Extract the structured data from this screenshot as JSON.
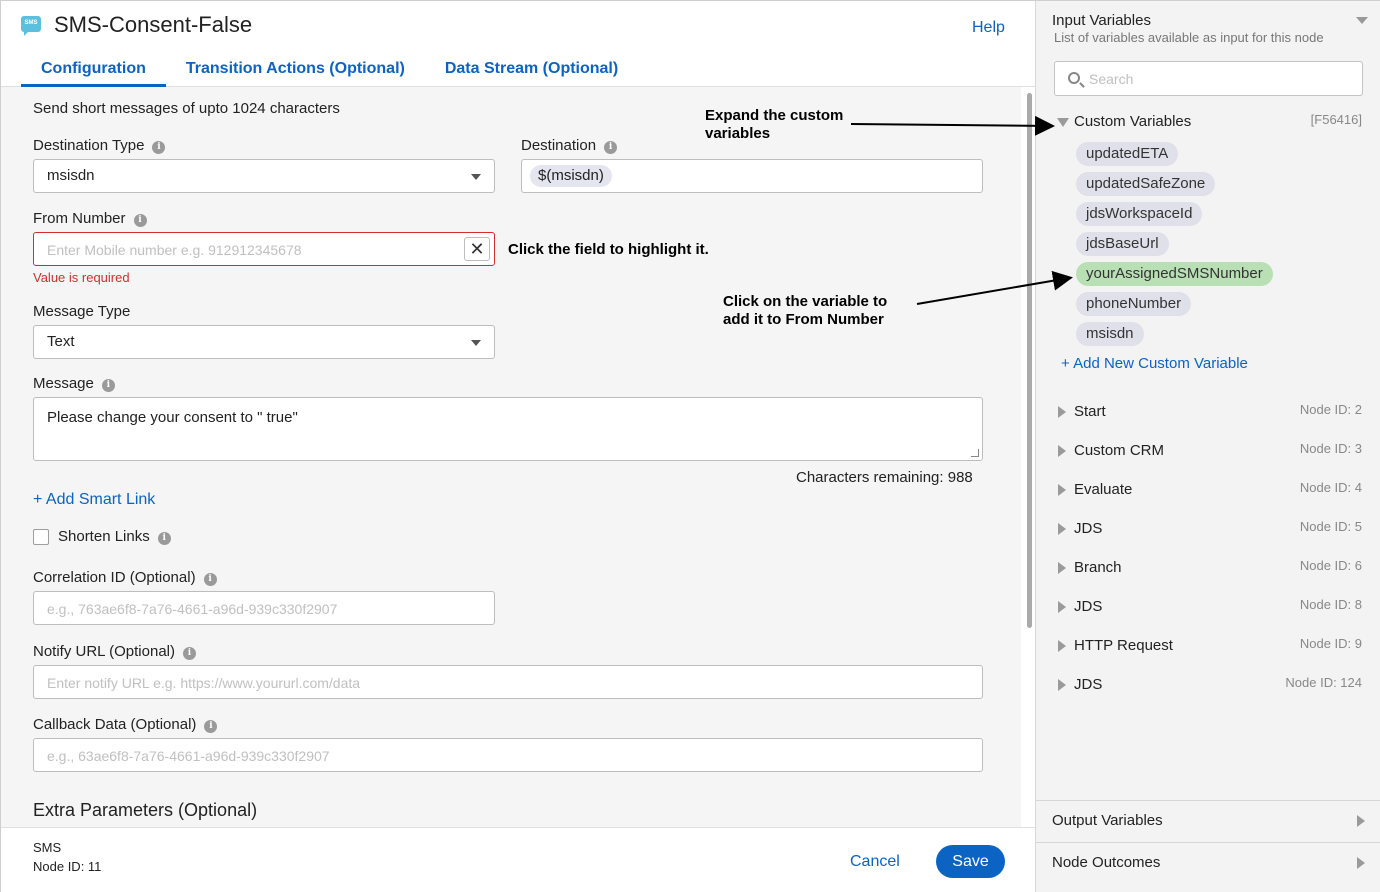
{
  "header": {
    "icon": "sms-icon",
    "icon_text": "SMS",
    "title": "SMS-Consent-False",
    "help": "Help",
    "tabs": [
      {
        "label": "Configuration"
      },
      {
        "label": "Transition Actions (Optional)"
      },
      {
        "label": "Data Stream (Optional)"
      }
    ]
  },
  "form": {
    "description": "Send short messages of upto 1024 characters",
    "destination_type": {
      "label": "Destination Type",
      "value": "msisdn"
    },
    "destination": {
      "label": "Destination",
      "chip": "$(msisdn)"
    },
    "from_number": {
      "label": "From Number",
      "placeholder": "Enter Mobile number e.g. 912912345678",
      "error": "Value is required"
    },
    "message_type": {
      "label": "Message Type",
      "value": "Text"
    },
    "message": {
      "label": "Message",
      "value": "Please change your consent to \" true\"",
      "remaining": "Characters remaining: 988"
    },
    "add_smart_link": "+ Add Smart Link",
    "shorten_links": "Shorten Links",
    "correlation_id": {
      "label": "Correlation ID (Optional)",
      "placeholder": "e.g., 763ae6f8-7a76-4661-a96d-939c330f2907"
    },
    "notify_url": {
      "label": "Notify URL (Optional)",
      "placeholder": "Enter notify URL e.g. https://www.yoururl.com/data"
    },
    "callback_data": {
      "label": "Callback Data (Optional)",
      "placeholder": "e.g., 63ae6f8-7a76-4661-a96d-939c330f2907"
    },
    "extra_parameters": "Extra Parameters (Optional)"
  },
  "annotations": {
    "expand_line1": "Expand the custom",
    "expand_line2": "variables",
    "click_field": "Click the field to highlight it.",
    "click_var_line1": "Click on the variable to",
    "click_var_line2": "add it to From Number"
  },
  "footer": {
    "node_type": "SMS",
    "node_id": "Node ID: 11",
    "cancel": "Cancel",
    "save": "Save"
  },
  "input_panel": {
    "title": "Input Variables",
    "subtitle": "List of variables available as input for this node",
    "search_placeholder": "Search",
    "custom_variables": {
      "label": "Custom Variables",
      "id": "[F56416]",
      "items": [
        "updatedETA",
        "updatedSafeZone",
        "jdsWorkspaceId",
        "jdsBaseUrl",
        "yourAssignedSMSNumber",
        "phoneNumber",
        "msisdn"
      ],
      "add_new": "+ Add New Custom Variable"
    },
    "nodes": [
      {
        "label": "Start",
        "id": "Node ID: 2"
      },
      {
        "label": "Custom CRM",
        "id": "Node ID: 3"
      },
      {
        "label": "Evaluate",
        "id": "Node ID: 4"
      },
      {
        "label": "JDS",
        "id": "Node ID: 5"
      },
      {
        "label": "Branch",
        "id": "Node ID: 6"
      },
      {
        "label": "JDS",
        "id": "Node ID: 8"
      },
      {
        "label": "HTTP Request",
        "id": "Node ID: 9"
      },
      {
        "label": "JDS",
        "id": "Node ID: 124"
      }
    ],
    "output_variables": "Output Variables",
    "node_outcomes": "Node Outcomes"
  },
  "colors": {
    "accent": "#0b63c4",
    "error": "#d32f2f",
    "highlight": "#b9e0b4"
  }
}
